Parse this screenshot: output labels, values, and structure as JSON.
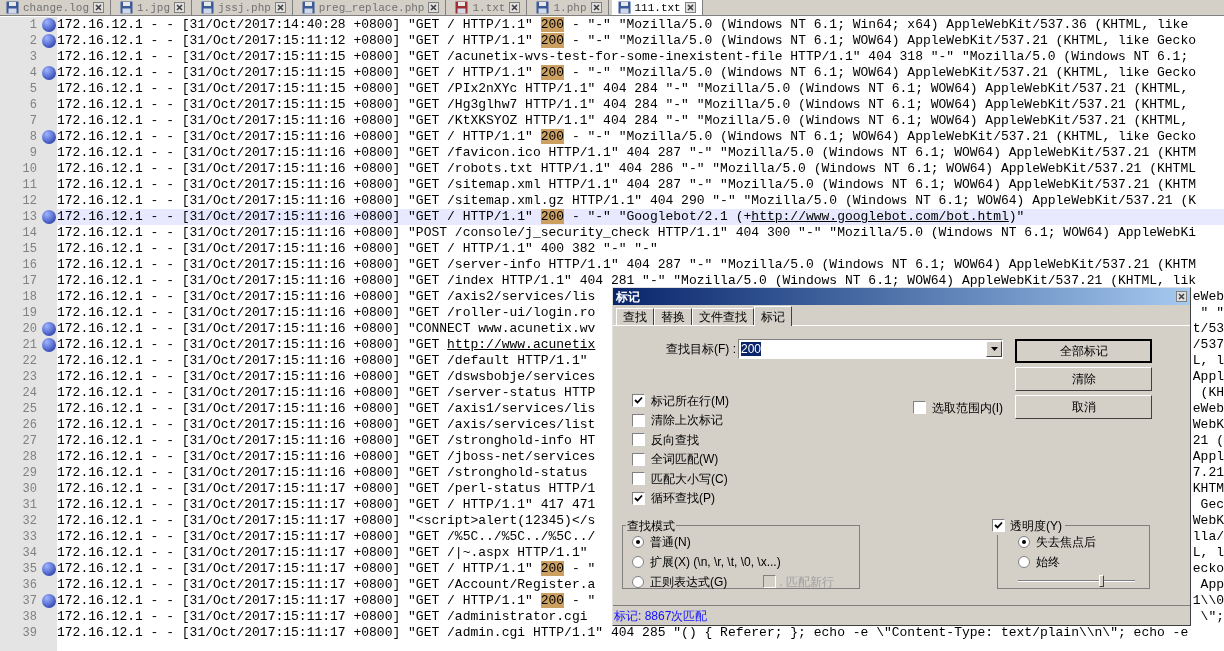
{
  "tabs": [
    {
      "label": "change.log",
      "selected": false,
      "modified": false
    },
    {
      "label": "1.jpg",
      "selected": false,
      "modified": false
    },
    {
      "label": "jssj.php",
      "selected": false,
      "modified": false
    },
    {
      "label": "preg_replace.php",
      "selected": false,
      "modified": false
    },
    {
      "label": "1.txt",
      "selected": false,
      "modified": true
    },
    {
      "label": "1.php",
      "selected": false,
      "modified": false
    },
    {
      "label": "111.txt",
      "selected": true,
      "modified": false
    }
  ],
  "lines": [
    {
      "number": "1",
      "bookmarked": true,
      "current": false,
      "segments": [
        {
          "kind": "plain",
          "text": "172.16.12.1 - - [31/Oct/2017:14:40:28 +0800] \"GET / HTTP/1.1\" "
        },
        {
          "kind": "match",
          "text": "200"
        },
        {
          "kind": "plain",
          "text": " - \"-\" \"Mozilla/5.0 (Windows NT 6.1; Win64; x64) AppleWebKit/537.36 (KHTML, like"
        }
      ]
    },
    {
      "number": "2",
      "bookmarked": true,
      "current": false,
      "segments": [
        {
          "kind": "plain",
          "text": "172.16.12.1 - - [31/Oct/2017:15:11:12 +0800] \"GET / HTTP/1.1\" "
        },
        {
          "kind": "match",
          "text": "200"
        },
        {
          "kind": "plain",
          "text": " - \"-\" \"Mozilla/5.0 (Windows NT 6.1; WOW64) AppleWebKit/537.21 (KHTML, like Gecko"
        }
      ]
    },
    {
      "number": "3",
      "bookmarked": false,
      "current": false,
      "segments": [
        {
          "kind": "plain",
          "text": "172.16.12.1 - - [31/Oct/2017:15:11:15 +0800] \"GET /acunetix-wvs-test-for-some-inexistent-file HTTP/1.1\" 404 318 \"-\" \"Mozilla/5.0 (Windows NT 6.1;"
        }
      ]
    },
    {
      "number": "4",
      "bookmarked": true,
      "current": false,
      "segments": [
        {
          "kind": "plain",
          "text": "172.16.12.1 - - [31/Oct/2017:15:11:15 +0800] \"GET / HTTP/1.1\" "
        },
        {
          "kind": "match",
          "text": "200"
        },
        {
          "kind": "plain",
          "text": " - \"-\" \"Mozilla/5.0 (Windows NT 6.1; WOW64) AppleWebKit/537.21 (KHTML, like Gecko"
        }
      ]
    },
    {
      "number": "5",
      "bookmarked": false,
      "current": false,
      "segments": [
        {
          "kind": "plain",
          "text": "172.16.12.1 - - [31/Oct/2017:15:11:15 +0800] \"GET /PIx2nXYc HTTP/1.1\" 404 284 \"-\" \"Mozilla/5.0 (Windows NT 6.1; WOW64) AppleWebKit/537.21 (KHTML,"
        }
      ]
    },
    {
      "number": "6",
      "bookmarked": false,
      "current": false,
      "segments": [
        {
          "kind": "plain",
          "text": "172.16.12.1 - - [31/Oct/2017:15:11:15 +0800] \"GET /Hg3glhw7 HTTP/1.1\" 404 284 \"-\" \"Mozilla/5.0 (Windows NT 6.1; WOW64) AppleWebKit/537.21 (KHTML,"
        }
      ]
    },
    {
      "number": "7",
      "bookmarked": false,
      "current": false,
      "segments": [
        {
          "kind": "plain",
          "text": "172.16.12.1 - - [31/Oct/2017:15:11:16 +0800] \"GET /KtXKSYOZ HTTP/1.1\" 404 284 \"-\" \"Mozilla/5.0 (Windows NT 6.1; WOW64) AppleWebKit/537.21 (KHTML,"
        }
      ]
    },
    {
      "number": "8",
      "bookmarked": true,
      "current": false,
      "segments": [
        {
          "kind": "plain",
          "text": "172.16.12.1 - - [31/Oct/2017:15:11:16 +0800] \"GET / HTTP/1.1\" "
        },
        {
          "kind": "match",
          "text": "200"
        },
        {
          "kind": "plain",
          "text": " - \"-\" \"Mozilla/5.0 (Windows NT 6.1; WOW64) AppleWebKit/537.21 (KHTML, like Gecko"
        }
      ]
    },
    {
      "number": "9",
      "bookmarked": false,
      "current": false,
      "segments": [
        {
          "kind": "plain",
          "text": "172.16.12.1 - - [31/Oct/2017:15:11:16 +0800] \"GET /favicon.ico HTTP/1.1\" 404 287 \"-\" \"Mozilla/5.0 (Windows NT 6.1; WOW64) AppleWebKit/537.21 (KHTM"
        }
      ]
    },
    {
      "number": "10",
      "bookmarked": false,
      "current": false,
      "segments": [
        {
          "kind": "plain",
          "text": "172.16.12.1 - - [31/Oct/2017:15:11:16 +0800] \"GET /robots.txt HTTP/1.1\" 404 286 \"-\" \"Mozilla/5.0 (Windows NT 6.1; WOW64) AppleWebKit/537.21 (KHTML"
        }
      ]
    },
    {
      "number": "11",
      "bookmarked": false,
      "current": false,
      "segments": [
        {
          "kind": "plain",
          "text": "172.16.12.1 - - [31/Oct/2017:15:11:16 +0800] \"GET /sitemap.xml HTTP/1.1\" 404 287 \"-\" \"Mozilla/5.0 (Windows NT 6.1; WOW64) AppleWebKit/537.21 (KHTM"
        }
      ]
    },
    {
      "number": "12",
      "bookmarked": false,
      "current": false,
      "segments": [
        {
          "kind": "plain",
          "text": "172.16.12.1 - - [31/Oct/2017:15:11:16 +0800] \"GET /sitemap.xml.gz HTTP/1.1\" 404 290 \"-\" \"Mozilla/5.0 (Windows NT 6.1; WOW64) AppleWebKit/537.21 (K"
        }
      ]
    },
    {
      "number": "13",
      "bookmarked": true,
      "current": true,
      "segments": [
        {
          "kind": "plain",
          "text": "172.16.12.1 - - [31/Oct/2017:15:11:16 +0800] \"GET / HTTP/1.1\" "
        },
        {
          "kind": "match",
          "text": "200"
        },
        {
          "kind": "plain",
          "text": " - \"-\" \"Googlebot/2.1 (+"
        },
        {
          "kind": "link",
          "text": "http://www.googlebot.com/bot.html"
        },
        {
          "kind": "plain",
          "text": ")\""
        }
      ]
    },
    {
      "number": "14",
      "bookmarked": false,
      "current": false,
      "segments": [
        {
          "kind": "plain",
          "text": "172.16.12.1 - - [31/Oct/2017:15:11:16 +0800] \"POST /console/j_security_check HTTP/1.1\" 404 300 \"-\" \"Mozilla/5.0 (Windows NT 6.1; WOW64) AppleWebKi"
        }
      ]
    },
    {
      "number": "15",
      "bookmarked": false,
      "current": false,
      "segments": [
        {
          "kind": "plain",
          "text": "172.16.12.1 - - [31/Oct/2017:15:11:16 +0800] \"GET / HTTP/1.1\" 400 382 \"-\" \"-\""
        }
      ]
    },
    {
      "number": "16",
      "bookmarked": false,
      "current": false,
      "segments": [
        {
          "kind": "plain",
          "text": "172.16.12.1 - - [31/Oct/2017:15:11:16 +0800] \"GET /server-info HTTP/1.1\" 404 287 \"-\" \"Mozilla/5.0 (Windows NT 6.1; WOW64) AppleWebKit/537.21 (KHTM"
        }
      ]
    },
    {
      "number": "17",
      "bookmarked": false,
      "current": false,
      "segments": [
        {
          "kind": "plain",
          "text": "172.16.12.1 - - [31/Oct/2017:15:11:16 +0800] \"GET /index HTTP/1.1\" 404 281 \"-\" \"Mozilla/5.0 (Windows NT 6.1; WOW64) AppleWebKit/537.21 (KHTML, lik"
        }
      ]
    },
    {
      "number": "18",
      "bookmarked": false,
      "current": false,
      "segments": [
        {
          "kind": "plain",
          "text": "172.16.12.1 - - [31/Oct/2017:15:11:16 +0800] \"GET /axis2/services/lis"
        }
      ],
      "tail": "eWeb"
    },
    {
      "number": "19",
      "bookmarked": false,
      "current": false,
      "segments": [
        {
          "kind": "plain",
          "text": "172.16.12.1 - - [31/Oct/2017:15:11:16 +0800] \"GET /roller-ui/login.ro"
        }
      ],
      "tail": "\" \""
    },
    {
      "number": "20",
      "bookmarked": true,
      "current": false,
      "segments": [
        {
          "kind": "plain",
          "text": "172.16.12.1 - - [31/Oct/2017:15:11:16 +0800] \"CONNECT www.acunetix.wv"
        }
      ],
      "tail": "t/53"
    },
    {
      "number": "21",
      "bookmarked": true,
      "current": false,
      "segments": [
        {
          "kind": "plain",
          "text": "172.16.12.1 - - [31/Oct/2017:15:11:16 +0800] \"GET "
        },
        {
          "kind": "link",
          "text": "http://www.acunetix"
        }
      ],
      "tail": "/537"
    },
    {
      "number": "22",
      "bookmarked": false,
      "current": false,
      "segments": [
        {
          "kind": "plain",
          "text": "172.16.12.1 - - [31/Oct/2017:15:11:16 +0800] \"GET /default HTTP/1.1\""
        }
      ],
      "tail": "L, l"
    },
    {
      "number": "23",
      "bookmarked": false,
      "current": false,
      "segments": [
        {
          "kind": "plain",
          "text": "172.16.12.1 - - [31/Oct/2017:15:11:16 +0800] \"GET /dswsbobje/services"
        }
      ],
      "tail": "Appl"
    },
    {
      "number": "24",
      "bookmarked": false,
      "current": false,
      "segments": [
        {
          "kind": "plain",
          "text": "172.16.12.1 - - [31/Oct/2017:15:11:16 +0800] \"GET /server-status HTTP"
        }
      ],
      "tail": "(KH"
    },
    {
      "number": "25",
      "bookmarked": false,
      "current": false,
      "segments": [
        {
          "kind": "plain",
          "text": "172.16.12.1 - - [31/Oct/2017:15:11:16 +0800] \"GET /axis1/services/lis"
        }
      ],
      "tail": "eWeb"
    },
    {
      "number": "26",
      "bookmarked": false,
      "current": false,
      "segments": [
        {
          "kind": "plain",
          "text": "172.16.12.1 - - [31/Oct/2017:15:11:16 +0800] \"GET /axis/services/list"
        }
      ],
      "tail": "WebK"
    },
    {
      "number": "27",
      "bookmarked": false,
      "current": false,
      "segments": [
        {
          "kind": "plain",
          "text": "172.16.12.1 - - [31/Oct/2017:15:11:16 +0800] \"GET /stronghold-info HT"
        }
      ],
      "tail": "21 ("
    },
    {
      "number": "28",
      "bookmarked": false,
      "current": false,
      "segments": [
        {
          "kind": "plain",
          "text": "172.16.12.1 - - [31/Oct/2017:15:11:16 +0800] \"GET /jboss-net/services"
        }
      ],
      "tail": "Appl"
    },
    {
      "number": "29",
      "bookmarked": false,
      "current": false,
      "segments": [
        {
          "kind": "plain",
          "text": "172.16.12.1 - - [31/Oct/2017:15:11:16 +0800] \"GET /stronghold-status"
        }
      ],
      "tail": "7.21"
    },
    {
      "number": "30",
      "bookmarked": false,
      "current": false,
      "segments": [
        {
          "kind": "plain",
          "text": "172.16.12.1 - - [31/Oct/2017:15:11:17 +0800] \"GET /perl-status HTTP/1"
        }
      ],
      "tail": "KHTM"
    },
    {
      "number": "31",
      "bookmarked": false,
      "current": false,
      "segments": [
        {
          "kind": "plain",
          "text": "172.16.12.1 - - [31/Oct/2017:15:11:17 +0800] \"GET / HTTP/1.1\" 417 471"
        }
      ],
      "tail": "Gec"
    },
    {
      "number": "32",
      "bookmarked": false,
      "current": false,
      "segments": [
        {
          "kind": "plain",
          "text": "172.16.12.1 - - [31/Oct/2017:15:11:17 +0800] \"<script>alert(12345)</s"
        }
      ],
      "tail": "WebK"
    },
    {
      "number": "33",
      "bookmarked": false,
      "current": false,
      "segments": [
        {
          "kind": "plain",
          "text": "172.16.12.1 - - [31/Oct/2017:15:11:17 +0800] \"GET /%5C../%5C../%5C../"
        }
      ],
      "tail": "lla/"
    },
    {
      "number": "34",
      "bookmarked": false,
      "current": false,
      "segments": [
        {
          "kind": "plain",
          "text": "172.16.12.1 - - [31/Oct/2017:15:11:17 +0800] \"GET /|~.aspx HTTP/1.1\""
        }
      ],
      "tail": "L, l"
    },
    {
      "number": "35",
      "bookmarked": true,
      "current": false,
      "segments": [
        {
          "kind": "plain",
          "text": "172.16.12.1 - - [31/Oct/2017:15:11:17 +0800] \"GET / HTTP/1.1\" "
        },
        {
          "kind": "match",
          "text": "200"
        },
        {
          "kind": "plain",
          "text": " - \""
        }
      ],
      "tail": "ecko"
    },
    {
      "number": "36",
      "bookmarked": false,
      "current": false,
      "segments": [
        {
          "kind": "plain",
          "text": "172.16.12.1 - - [31/Oct/2017:15:11:17 +0800] \"GET /Account/Register.a"
        }
      ],
      "tail": "App"
    },
    {
      "number": "37",
      "bookmarked": true,
      "current": false,
      "segments": [
        {
          "kind": "plain",
          "text": "172.16.12.1 - - [31/Oct/2017:15:11:17 +0800] \"GET / HTTP/1.1\" "
        },
        {
          "kind": "match",
          "text": "200"
        },
        {
          "kind": "plain",
          "text": " - \""
        }
      ],
      "tail": "1\\\\0"
    },
    {
      "number": "38",
      "bookmarked": false,
      "current": false,
      "segments": [
        {
          "kind": "plain",
          "text": "172.16.12.1 - - [31/Oct/2017:15:11:17 +0800] \"GET /administrator.cgi"
        }
      ],
      "tail": "\\\";"
    },
    {
      "number": "39",
      "bookmarked": false,
      "current": false,
      "segments": [
        {
          "kind": "plain",
          "text": "172.16.12.1 - - [31/Oct/2017:15:11:17 +0800] \"GET /admin.cgi HTTP/1.1\" 404 285 \"() { Referer; }; echo -e \\\"Content-Type: text/plain\\\\n\\\"; echo -e"
        }
      ]
    }
  ],
  "dialog": {
    "title": "标记",
    "tabs": [
      {
        "label": "查找",
        "selected": false
      },
      {
        "label": "替换",
        "selected": false
      },
      {
        "label": "文件查找",
        "selected": false
      },
      {
        "label": "标记",
        "selected": true
      }
    ],
    "find_label": "查找目标(F) :",
    "find_value": "200",
    "buttons": [
      {
        "label": "全部标记",
        "default": true
      },
      {
        "label": "清除",
        "default": false
      },
      {
        "label": "取消",
        "default": false
      }
    ],
    "options": [
      {
        "label": "标记所在行(M)",
        "checked": true
      },
      {
        "label": "清除上次标记",
        "checked": false
      },
      {
        "label": "反向查找",
        "checked": false
      },
      {
        "label": "全词匹配(W)",
        "checked": false
      },
      {
        "label": "匹配大小写(C)",
        "checked": false
      },
      {
        "label": "循环查找(P)",
        "checked": true
      }
    ],
    "in_selection": {
      "label": "选取范围内(I)",
      "checked": false
    },
    "search_mode": {
      "title": "查找模式",
      "modes": [
        {
          "label": "普通(N)",
          "selected": true
        },
        {
          "label": "扩展(X) (\\n, \\r, \\t, \\0, \\x...)",
          "selected": false
        },
        {
          "label": "正则表达式(G)",
          "selected": false
        }
      ],
      "dot_newline": {
        "label": ". 匹配新行",
        "checked": false,
        "disabled": true
      }
    },
    "transparency": {
      "label": "透明度(Y)",
      "checked": true,
      "modes": [
        {
          "label": "失去焦点后",
          "selected": true
        },
        {
          "label": "始终",
          "selected": false
        }
      ],
      "level": 0.72
    },
    "status": "标记: 8867次匹配"
  }
}
